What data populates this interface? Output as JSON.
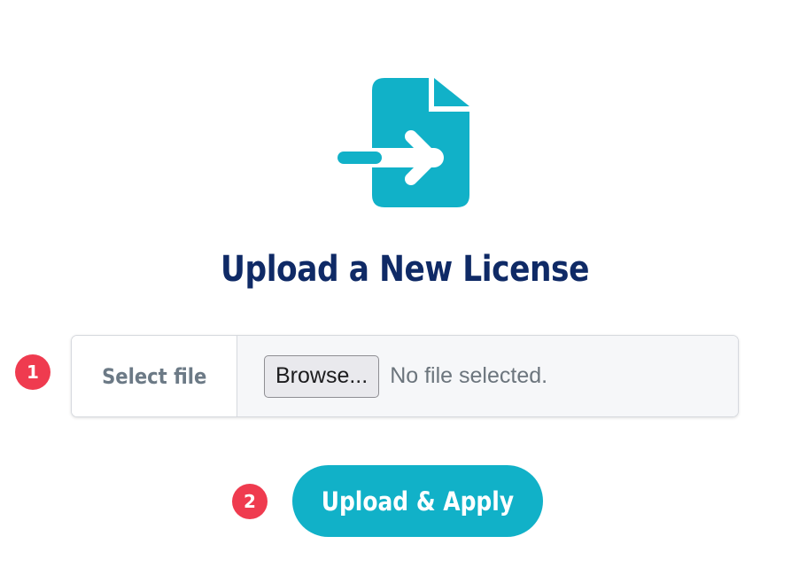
{
  "icon": "file-import-icon",
  "colors": {
    "accent": "#11b1c8",
    "title": "#0f2a66",
    "badge": "#ef3b4f"
  },
  "title": "Upload a New License",
  "steps": [
    "1",
    "2"
  ],
  "file_field": {
    "label": "Select file",
    "browse_label": "Browse...",
    "status": "No file selected."
  },
  "submit_label": "Upload & Apply"
}
